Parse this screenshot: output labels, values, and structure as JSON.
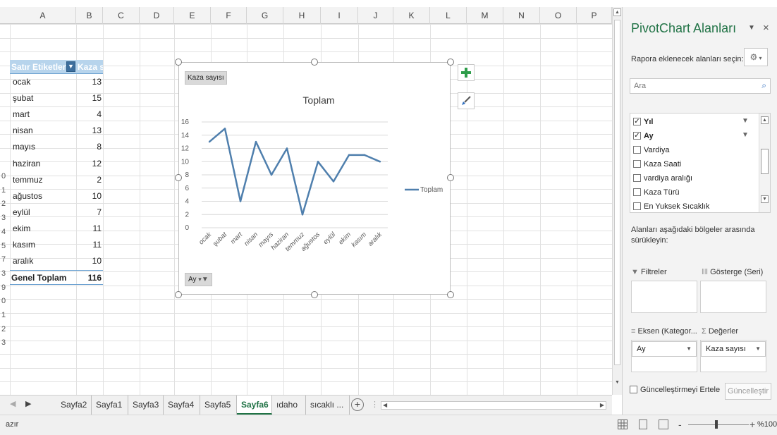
{
  "columns": [
    "A",
    "B",
    "C",
    "D",
    "E",
    "F",
    "G",
    "H",
    "I",
    "J",
    "K",
    "L",
    "M",
    "N",
    "O",
    "P"
  ],
  "row_numbers": [
    "0",
    "1",
    "2",
    "3",
    "4",
    "5",
    "7",
    "3",
    "9",
    "0",
    "1",
    "2",
    "3"
  ],
  "pivot": {
    "header_row_label": "Satır Etiketleri",
    "header_value_label": "Kaza sa",
    "rows": [
      {
        "label": "ocak",
        "value": "13"
      },
      {
        "label": "şubat",
        "value": "15"
      },
      {
        "label": "mart",
        "value": "4"
      },
      {
        "label": "nisan",
        "value": "13"
      },
      {
        "label": "mayıs",
        "value": "8"
      },
      {
        "label": "haziran",
        "value": "12"
      },
      {
        "label": "temmuz",
        "value": "2"
      },
      {
        "label": "ağustos",
        "value": "10"
      },
      {
        "label": "eylül",
        "value": "7"
      },
      {
        "label": "ekim",
        "value": "11"
      },
      {
        "label": "kasım",
        "value": "11"
      },
      {
        "label": "aralık",
        "value": "10"
      }
    ],
    "total_label": "Genel Toplam",
    "total_value": "116"
  },
  "chart_data": {
    "type": "line",
    "title": "Toplam",
    "value_field_button": "Kaza sayısı",
    "axis_field_button": "Ay",
    "categories": [
      "ocak",
      "şubat",
      "mart",
      "nisan",
      "mayıs",
      "haziran",
      "temmuz",
      "ağustos",
      "eylül",
      "ekim",
      "kasım",
      "aralık"
    ],
    "series": [
      {
        "name": "Toplam",
        "values": [
          13,
          15,
          4,
          13,
          8,
          12,
          2,
          10,
          7,
          11,
          11,
          10
        ],
        "color": "#4f7fad"
      }
    ],
    "ylim": [
      0,
      16
    ],
    "yticks": [
      "0",
      "2",
      "4",
      "6",
      "8",
      "10",
      "12",
      "14",
      "16"
    ],
    "grid": true,
    "legend": "right",
    "xlabel": "",
    "ylabel": ""
  },
  "tabs": [
    "Sayfa2",
    "Sayfa1",
    "Sayfa3",
    "Sayfa4",
    "Sayfa5",
    "Sayfa6",
    "ıdaho",
    "sıcaklı ..."
  ],
  "active_tab": "Sayfa6",
  "status": {
    "left": "azır",
    "zoom": "%100"
  },
  "pane": {
    "title": "PivotChart Alanları",
    "choose_fields": "Rapora eklenecek alanları seçin:",
    "search_placeholder": "Ara",
    "fields": [
      {
        "label": "Yıl",
        "checked": true
      },
      {
        "label": "Ay",
        "checked": true
      },
      {
        "label": "Vardiya",
        "checked": false
      },
      {
        "label": "Kaza Saati",
        "checked": false
      },
      {
        "label": "vardiya aralığı",
        "checked": false
      },
      {
        "label": "Kaza Türü",
        "checked": false
      },
      {
        "label": "En Yuksek Sıcaklık",
        "checked": false
      }
    ],
    "drag_text_1": "Alanları aşağıdaki bölgeler arasında",
    "drag_text_2": "sürükleyin:",
    "filters_label": "Filtreler",
    "legend_label": "Gösterge (Seri)",
    "axis_label": "Eksen (Kategor...",
    "values_label": "Değerler",
    "axis_value": "Ay",
    "values_value": "Kaza sayısı",
    "defer_label": "Güncelleştirmeyi Ertele",
    "update_button": "Güncelleştir"
  },
  "colors": {
    "accent": "#217346",
    "line": "#4f7fad",
    "pivot_header": "#b7d4ec"
  }
}
